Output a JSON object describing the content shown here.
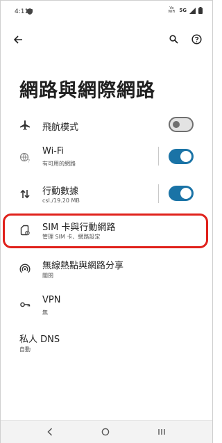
{
  "status_bar": {
    "time": "4:11",
    "vowifi": "Vo WiFi",
    "network": "5G"
  },
  "page": {
    "title": "網路與網際網路"
  },
  "items": [
    {
      "title": "飛航模式",
      "toggle": "off"
    },
    {
      "title": "Wi-Fi",
      "subtitle": "有可用的網路",
      "toggle": "on"
    },
    {
      "title": "行動數據",
      "subtitle": "csl./19.20 MB",
      "toggle": "on"
    },
    {
      "title": "SIM 卡與行動網路",
      "subtitle": "管理 SIM 卡、網路設定"
    },
    {
      "title": "無線熱點與網路分享",
      "subtitle": "關閉"
    },
    {
      "title": "VPN",
      "subtitle": "無"
    },
    {
      "title": "私人 DNS",
      "subtitle": "自動"
    }
  ],
  "icons": {
    "back": "back-arrow-icon",
    "search": "search-icon",
    "help": "help-icon",
    "airplane": "airplane-icon",
    "wifi": "wifi-icon",
    "data": "mobile-data-icon",
    "sim": "sim-card-icon",
    "hotspot": "hotspot-icon",
    "vpn": "vpn-key-icon"
  },
  "colors": {
    "accent": "#1a73a6",
    "highlight": "#e0211b"
  }
}
